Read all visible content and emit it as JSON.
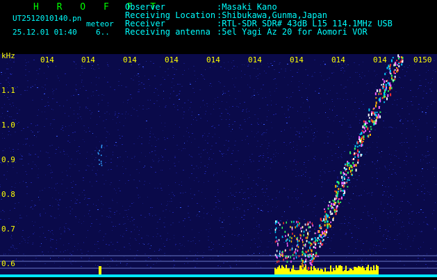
{
  "header": {
    "brand": "H R O F F T",
    "filename": "UT2512010140.pn",
    "tagline": "meteor",
    "datetime": "25.12.01 01:40",
    "page": "6..",
    "fields": [
      {
        "key": "Observer",
        "value": ":Masaki Kano"
      },
      {
        "key": "Receiving Location",
        "value": ":Shibukawa,Gunma,Japan"
      },
      {
        "key": "Receiver",
        "value": ":RTL-SDR SDR# 43dB L15 114.1MHz USB"
      },
      {
        "key": "Receiving antenna",
        "value": ":5el Yagi Az 20 for Aomori VOR"
      }
    ]
  },
  "plot": {
    "y_unit": "kHz",
    "y_ticks": [
      "1.1",
      "1.0",
      "0.9",
      "0.8",
      "0.7",
      "0.6"
    ],
    "x_ticks": [
      "014",
      "014",
      "014",
      "014",
      "014",
      "014",
      "014",
      "014",
      "014",
      "0150"
    ]
  },
  "colors": {
    "header_text": "#00ffff",
    "brand": "#00ff00",
    "axis_text": "#ffff00",
    "background": "#0a0a4a",
    "noise": "#1c22a0",
    "baseline": "#00e5ff",
    "signal_band": "#ffff00"
  }
}
